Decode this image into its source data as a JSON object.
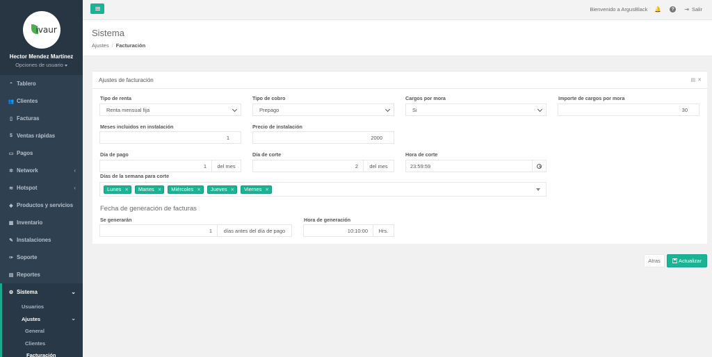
{
  "user": {
    "logo_text": "ivaur",
    "name": "Hector Mendez Martínez",
    "options_label": "Opciones de usuario"
  },
  "sidebar": {
    "items": [
      {
        "label": "Tablero",
        "icon": "dashboard-icon",
        "glyph": "◓"
      },
      {
        "label": "Clientes",
        "icon": "users-icon",
        "glyph": "👥"
      },
      {
        "label": "Facturas",
        "icon": "file-icon",
        "glyph": "▯"
      },
      {
        "label": "Ventas rápidas",
        "icon": "dollar-icon",
        "glyph": "$"
      },
      {
        "label": "Pagos",
        "icon": "money-icon",
        "glyph": "▭"
      },
      {
        "label": "Network",
        "icon": "network-icon",
        "glyph": "✲"
      },
      {
        "label": "Hotspot",
        "icon": "wifi-icon",
        "glyph": "≋"
      },
      {
        "label": "Productos y servicios",
        "icon": "tag-icon",
        "glyph": "◆"
      },
      {
        "label": "Inventario",
        "icon": "cubes-icon",
        "glyph": "▦"
      },
      {
        "label": "Instalaciones",
        "icon": "wrench-icon",
        "glyph": "✎"
      },
      {
        "label": "Soporte",
        "icon": "tool-icon",
        "glyph": "✑"
      },
      {
        "label": "Reportes",
        "icon": "report-icon",
        "glyph": "▤"
      },
      {
        "label": "Sistema",
        "icon": "cogs-icon",
        "glyph": "⚙"
      }
    ],
    "sistema_sub": {
      "usuarios": "Usuarios",
      "ajustes": "Ajustes",
      "general": "General",
      "clientes": "Clientes",
      "facturacion": "Facturación"
    }
  },
  "topbar": {
    "welcome": "Bienvenido a ArgusBlack",
    "logout": "Salir"
  },
  "heading": {
    "title": "Sistema",
    "breadcrumb_parent": "Ajustes",
    "breadcrumb_current": "Facturación"
  },
  "panel": {
    "title": "Ajustes de facturación"
  },
  "form": {
    "tipo_renta": {
      "label": "Tipo de renta",
      "value": "Renta mensual fija"
    },
    "tipo_cobro": {
      "label": "Tipo de cobro",
      "value": "Prepago"
    },
    "cargos_mora": {
      "label": "Cargos por mora",
      "value": "Si"
    },
    "importe_mora": {
      "label": "Importe de cargos por mora",
      "value": "30"
    },
    "meses_instalacion": {
      "label": "Meses incluidos en instalación",
      "value": "1"
    },
    "precio_instalacion": {
      "label": "Precio de instalación",
      "value": "2000"
    },
    "dia_pago": {
      "label": "Día de pago",
      "value": "1",
      "suffix": "del mes"
    },
    "dia_corte": {
      "label": "Día de corte",
      "value": "2",
      "suffix": "del mes"
    },
    "hora_corte": {
      "label": "Hora de corte",
      "value": "23:59:59"
    },
    "dias_semana": {
      "label": "Días de la semana para corte",
      "tags": [
        "Lunes",
        "Martes",
        "Miércoles",
        "Jueves",
        "Viernes"
      ]
    },
    "generacion_title": "Fecha de generación de facturas",
    "se_generaran": {
      "label": "Se generarán",
      "value": "1",
      "suffix": "días antes del día de pago"
    },
    "hora_generacion": {
      "label": "Hora de generación",
      "value": "10:10:00",
      "suffix": "Hrs."
    }
  },
  "actions": {
    "back": "Atras",
    "update": "Actualizar"
  },
  "colors": {
    "accent": "#1ab394",
    "sidebar": "#2f4050"
  }
}
